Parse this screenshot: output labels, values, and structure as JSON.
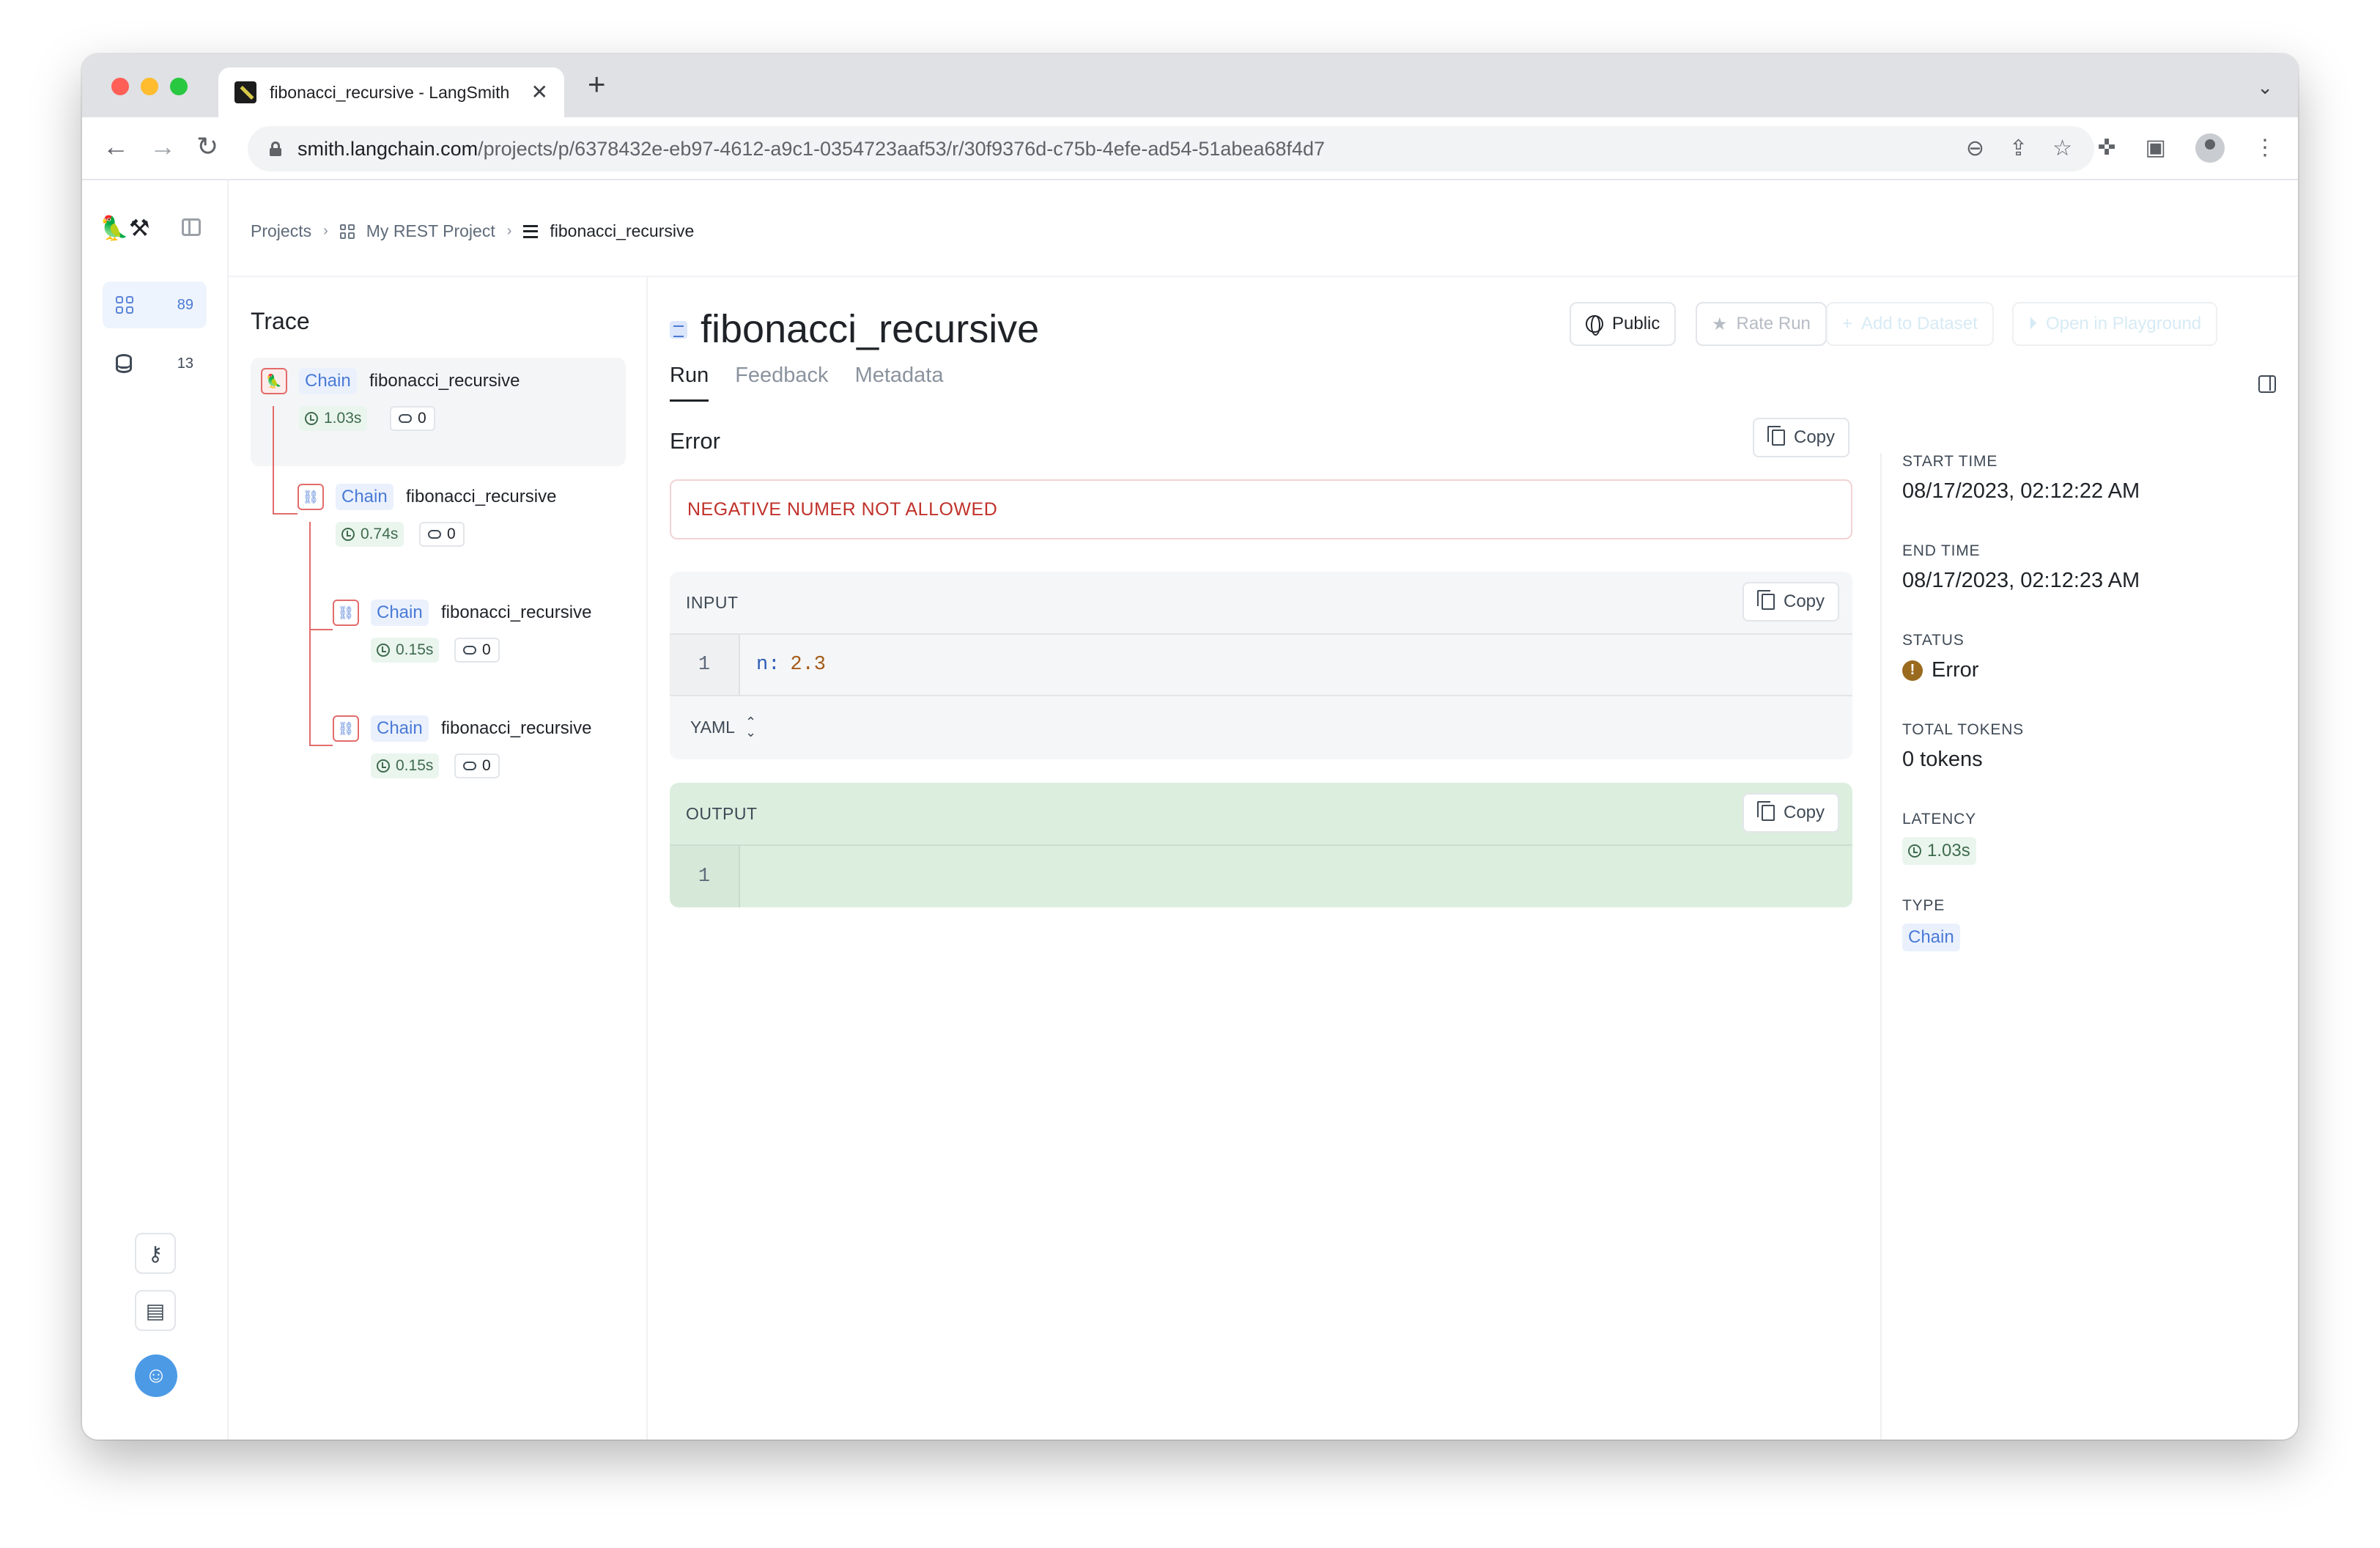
{
  "browser": {
    "tab_title": "fibonacci_recursive - LangSmith",
    "url_domain": "smith.langchain.com",
    "url_path": "/projects/p/6378432e-eb97-4612-a9c1-0354723aaf53/r/30f9376d-c75b-4efe-ad54-51abea68f4d7"
  },
  "rail": {
    "projects_count": "89",
    "datasets_count": "13"
  },
  "breadcrumb": {
    "projects": "Projects",
    "project": "My REST Project",
    "run": "fibonacci_recursive"
  },
  "trace": {
    "title": "Trace",
    "nodes": [
      {
        "type": "Chain",
        "name": "fibonacci_recursive",
        "latency": "1.03s",
        "tokens": "0"
      },
      {
        "type": "Chain",
        "name": "fibonacci_recursive",
        "latency": "0.74s",
        "tokens": "0"
      },
      {
        "type": "Chain",
        "name": "fibonacci_recursive",
        "latency": "0.15s",
        "tokens": "0"
      },
      {
        "type": "Chain",
        "name": "fibonacci_recursive",
        "latency": "0.15s",
        "tokens": "0"
      }
    ]
  },
  "run": {
    "title": "fibonacci_recursive",
    "actions": {
      "public": "Public",
      "rate_run": "Rate Run",
      "add_to_dataset": "Add to Dataset",
      "open_playground": "Open in Playground"
    },
    "tabs": [
      "Run",
      "Feedback",
      "Metadata"
    ],
    "error_label": "Error",
    "error_message": "NEGATIVE NUMER NOT ALLOWED",
    "copy_label": "Copy",
    "input": {
      "label": "INPUT",
      "line_no": "1",
      "key": "n:",
      "value": "2.3",
      "format": "YAML"
    },
    "output": {
      "label": "OUTPUT",
      "line_no": "1"
    }
  },
  "meta": {
    "start_time_label": "START TIME",
    "start_time": "08/17/2023, 02:12:22 AM",
    "end_time_label": "END TIME",
    "end_time": "08/17/2023, 02:12:23 AM",
    "status_label": "STATUS",
    "status": "Error",
    "total_tokens_label": "TOTAL TOKENS",
    "total_tokens": "0 tokens",
    "latency_label": "LATENCY",
    "latency": "1.03s",
    "type_label": "TYPE",
    "type": "Chain"
  },
  "colors": {
    "accent_blue": "#4a7ad6",
    "error_red": "#c0322b",
    "output_green": "#dcefdf",
    "tree_line": "#e36b6b"
  }
}
